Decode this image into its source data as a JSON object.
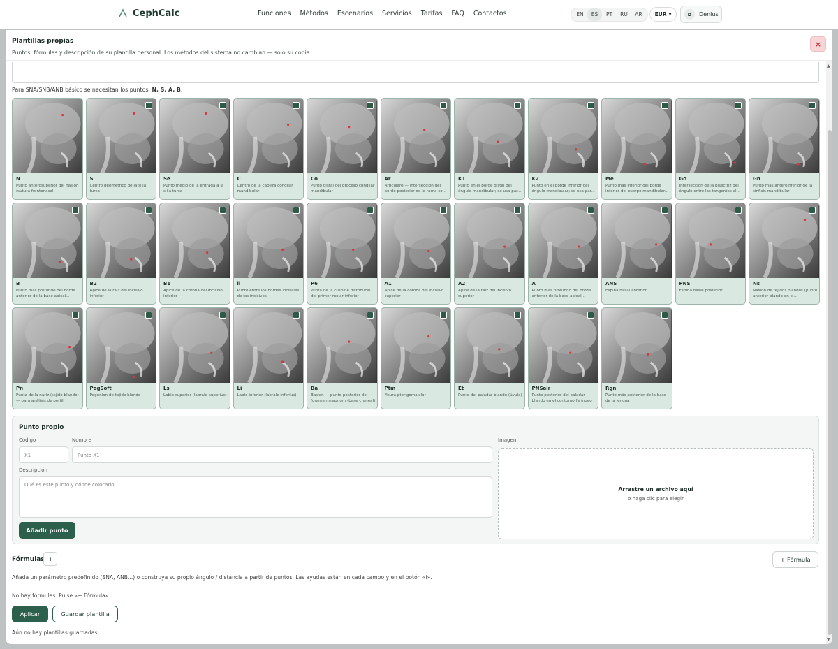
{
  "brand": {
    "name": "CephCalc"
  },
  "nav": [
    "Funciones",
    "Métodos",
    "Escenarios",
    "Servicios",
    "Tarifas",
    "FAQ",
    "Contactos"
  ],
  "langs": [
    "EN",
    "ES",
    "PT",
    "RU",
    "AR"
  ],
  "active_lang": "ES",
  "currency": "EUR",
  "user": {
    "initial": "D",
    "name": "Denius"
  },
  "modal": {
    "title": "Plantillas propias",
    "subtitle": "Puntos, fórmulas y descripción de su plantilla personal. Los métodos del sistema no cambian — solo su copia.",
    "close": "×",
    "hint_prefix": "Para SNA/SNB/ANB básico se necesitan los puntos: ",
    "hint_points": "N, S, A, B",
    "hint_suffix": "."
  },
  "points": [
    {
      "code": "N",
      "desc": "Punto anterosuperior del nasion (sutura frontonasal)"
    },
    {
      "code": "S",
      "desc": "Centro geométrico de la silla turca"
    },
    {
      "code": "Se",
      "desc": "Punto medio de la entrada a la silla turca"
    },
    {
      "code": "C",
      "desc": "Centro de la cabeza condilar mandibular"
    },
    {
      "code": "Co",
      "desc": "Punto distal del proceso condilar mandibular"
    },
    {
      "code": "Ar",
      "desc": "Articulare — intersección del borde posterior de la rama co..."
    },
    {
      "code": "K1",
      "desc": "Punto en el borde distal del ángulo mandibular; se usa par..."
    },
    {
      "code": "K2",
      "desc": "Punto en el borde inferior del ángulo mandibular; se usa par..."
    },
    {
      "code": "Me",
      "desc": "Punto más inferior del borde inferior del cuerpo mandibular..."
    },
    {
      "code": "Go",
      "desc": "Intersección de la bisectriz del ángulo entre las tangentes al..."
    },
    {
      "code": "Gn",
      "desc": "Punto más anteroinferior de la sínfisis mandibular"
    },
    {
      "code": "B",
      "desc": "Punto más profundo del borde anterior de la base apical..."
    },
    {
      "code": "B2",
      "desc": "Ápice de la raíz del incisivo inferior"
    },
    {
      "code": "B1",
      "desc": "Ápice de la corona del incisivo inferior"
    },
    {
      "code": "ii",
      "desc": "Punto entre los bordes incisales de los incisivos"
    },
    {
      "code": "P6",
      "desc": "Punta de la cúspide distobucal del primer molar inferior"
    },
    {
      "code": "A1",
      "desc": "Ápice de la corona del incisivo superior"
    },
    {
      "code": "A2",
      "desc": "Ápice de la raíz del incisivo superior"
    },
    {
      "code": "A",
      "desc": "Punto más profundo del borde anterior de la base apical..."
    },
    {
      "code": "ANS",
      "desc": "Espina nasal anterior"
    },
    {
      "code": "PNS",
      "desc": "Espina nasal posterior"
    },
    {
      "code": "Ns",
      "desc": "Nasion de tejidos blandos (punto anterior blando en el..."
    },
    {
      "code": "Pn",
      "desc": "Punta de la nariz (tejido blando) — para análisis de perfil"
    },
    {
      "code": "PogSoft",
      "desc": "Pogonion de tejido blando"
    },
    {
      "code": "Ls",
      "desc": "Labio superior (labrale superius)"
    },
    {
      "code": "Li",
      "desc": "Labio inferior (labrale inferius)"
    },
    {
      "code": "Ba",
      "desc": "Basion — punto posterior del foramen magnum (base craneal)"
    },
    {
      "code": "Ptm",
      "desc": "Fisura pterigomaxilar"
    },
    {
      "code": "Et",
      "desc": "Punta del paladar blando (úvula)"
    },
    {
      "code": "PNSair",
      "desc": "Punto posterior del paladar blando en el contorno faríngeo"
    },
    {
      "code": "Rgn",
      "desc": "Punto más posterior de la base de la lengua"
    }
  ],
  "form": {
    "title": "Punto propio",
    "code_label": "Código",
    "code_placeholder": "X1",
    "name_label": "Nombre",
    "name_placeholder": "Punto X1",
    "desc_label": "Descripción",
    "desc_placeholder": "Qué es este punto y dónde colocarlo",
    "image_label": "Imagen",
    "drop_title": "Arrastre un archivo aquí",
    "drop_sub": "o haga clic para elegir",
    "add_button": "Añadir punto"
  },
  "formulas": {
    "title": "Fórmulas",
    "info": "i",
    "add_button": "+ Fórmula",
    "help": "Añada un parámetro predefinido (SNA, ANB...) o construya su propio ángulo / distancia a partir de puntos. Las ayudas están en cada campo y en el botón «i».",
    "empty": "No hay fórmulas. Pulse «+ Fórmula»."
  },
  "actions": {
    "apply": "Aplicar",
    "save": "Guardar plantilla",
    "no_saved": "Aún no hay plantillas guardadas."
  },
  "colors": {
    "accent": "#2c5f4c",
    "card_bg": "#d9e9e1",
    "marker": "#e0303c",
    "close_bg": "#f8d6d7"
  }
}
